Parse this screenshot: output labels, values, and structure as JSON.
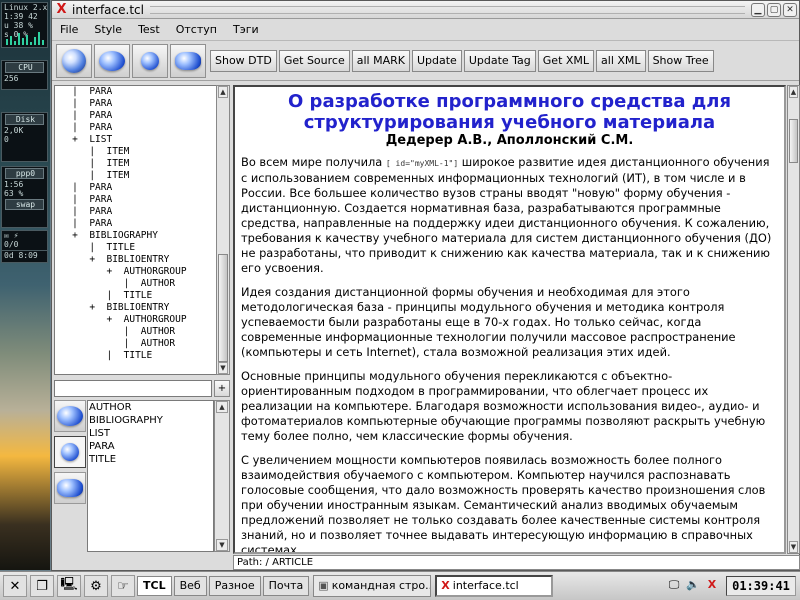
{
  "dock": {
    "os_label": "Linux 2.x",
    "load": "1:39  42",
    "user_cpu": "u 38 %",
    "sys_cpu": "s 0 %",
    "cpu_label": "CPU",
    "cpu_value": "256",
    "disk_label": "Disk",
    "disk_value": "2,0K",
    "disk_value2": "0",
    "ppp_label": "ppp0",
    "ppp_time": "1:56",
    "ppp_pct": "63 %",
    "swap_label": "swap",
    "mail_count": "0/0",
    "uptime": "0d   8:09"
  },
  "window": {
    "title": "interface.tcl",
    "app_icon": "X"
  },
  "menu": [
    "File",
    "Style",
    "Test",
    "Отступ",
    "Тэги"
  ],
  "toolbar": {
    "icons": [
      "orb-shiny-icon",
      "orb-pair-icon",
      "orb-icon",
      "orb-double-icon"
    ],
    "buttons": [
      "Show DTD",
      "Get Source",
      "all MARK",
      "Update",
      "Update Tag",
      "Get XML",
      "all XML",
      "Show Tree"
    ]
  },
  "tree": [
    "   |  PARA",
    "   |  PARA",
    "   |  PARA",
    "   |  PARA",
    "   +  LIST",
    "      |  ITEM",
    "      |  ITEM",
    "      |  ITEM",
    "   |  PARA",
    "   |  PARA",
    "   |  PARA",
    "   |  PARA",
    "   +  BIBLIOGRAPHY",
    "      |  TITLE",
    "      +  BIBLIOENTRY",
    "         +  AUTHORGROUP",
    "            |  AUTHOR",
    "         |  TITLE",
    "      +  BIBLIOENTRY",
    "         +  AUTHORGROUP",
    "            |  AUTHOR",
    "            |  AUTHOR",
    "         |  TITLE"
  ],
  "filter": {
    "value": "",
    "add_label": "+"
  },
  "tags": [
    "AUTHOR",
    "BIBLIOGRAPHY",
    "LIST",
    "PARA",
    "TITLE"
  ],
  "document": {
    "title_line1": "О разработке программного средства для",
    "title_line2": "структурирования учебного материала",
    "authors": "Дедерер А.В., Аполлонский С.М.",
    "p1_before": "Во всем мире получила ",
    "p1_id": "[ id=\"myXML-1\"]",
    "p1_after": " широкое развитие идея дистанционного обучения с использованием современных информационных технологий (ИТ), в том числе и в России. Все большее количество вузов страны вводят \"новую\" форму обучения - дистанционную. Создается нормативная база, разрабатываются программные средства, направленные на поддержку идеи дистанционного обучения. К сожалению, требования к качеству учебного материала для систем дистанционного обучения (ДО) не разработаны, что приводит к снижению как качества материала, так и к снижению его усвоения.",
    "p2": "Идея создания дистанционной формы обучения и необходимая для этого методологическая база - принципы модульного обучения и методика контроля успеваемости были разработаны еще в 70-х годах. Но только сейчас, когда современные информационные технологии получили массовое распространение (компьютеры и сеть Internet), стала возможной реализация этих идей.",
    "p3": "Основные принципы модульного обучения перекликаются с объектно-ориентированным подходом в программировании, что облегчает процесс их реализации на компьютере. Благодаря возможности использования видео-, аудио- и фотоматериалов компьютерные обучающие программы позволяют раскрыть учебную тему более полно, чем классические формы обучения.",
    "p4": "С увеличением мощности компьютеров появилась возможность более полного взаимодействия обучаемого с компьютером. Компьютер научился распознавать голосовые сообщения, что дало возможность проверять качество произношения слов при обучении иностранным языкам. Семантический анализ вводимых обучаемым предложений позволяет не только создавать более качественные системы контроля знаний, но и позволяет точнее выдавать интересующую информацию в справочных системах."
  },
  "path": "Path: / ARTICLE",
  "taskbar": {
    "workspaces": [
      "TCL",
      "Веб",
      "Разное",
      "Почта"
    ],
    "active_workspace": "TCL",
    "tasks": [
      "командная стро...",
      "interface.tcl"
    ],
    "active_task": "interface.tcl",
    "clock": "01:39:41"
  },
  "colors": {
    "title_blue": "#2222cc",
    "app_icon_red": "#d01818"
  }
}
